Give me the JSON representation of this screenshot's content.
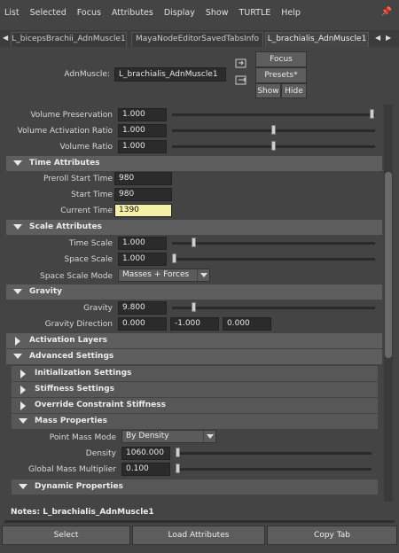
{
  "menu": [
    "List",
    "Selected",
    "Focus",
    "Attributes",
    "Display",
    "Show",
    "TURTLE",
    "Help"
  ],
  "tabs": [
    "L_bicepsBrachii_AdnMuscle1",
    "MayaNodeEditorSavedTabsInfo",
    "L_brachialis_AdnMuscle1"
  ],
  "node": {
    "label": "AdnMuscle:",
    "value": "L_brachialis_AdnMuscle1",
    "focus": "Focus",
    "presets": "Presets*",
    "show": "Show",
    "hide": "Hide"
  },
  "top_attrs": [
    {
      "label": "Volume Preservation",
      "value": "1.000",
      "slider": 1.0
    },
    {
      "label": "Volume Activation Ratio",
      "value": "1.000",
      "slider": 0.5
    },
    {
      "label": "Volume Ratio",
      "value": "1.000",
      "slider": 0.5
    }
  ],
  "time": {
    "title": "Time Attributes",
    "preroll_label": "Preroll Start Time",
    "preroll": "980",
    "start_label": "Start Time",
    "start": "980",
    "current_label": "Current Time",
    "current": "1390"
  },
  "scale": {
    "title": "Scale Attributes",
    "time_scale_label": "Time Scale",
    "time_scale": "1.000",
    "time_scale_slider": 0.1,
    "space_scale_label": "Space Scale",
    "space_scale": "1.000",
    "space_scale_slider": 0.0,
    "mode_label": "Space Scale Mode",
    "mode": "Masses + Forces"
  },
  "gravity": {
    "title": "Gravity",
    "gravity_label": "Gravity",
    "gravity": "9.800",
    "gravity_slider": 0.1,
    "dir_label": "Gravity Direction",
    "dir": [
      "0.000",
      "-1.000",
      "0.000"
    ]
  },
  "sections": {
    "activation": "Activation Layers",
    "advanced": "Advanced Settings",
    "init": "Initialization Settings",
    "stiffness": "Stiffness Settings",
    "override": "Override Constraint Stiffness",
    "mass": "Mass Properties",
    "dynamic": "Dynamic Properties"
  },
  "mass": {
    "mode_label": "Point Mass Mode",
    "mode": "By Density",
    "density_label": "Density",
    "density": "1060.000",
    "density_slider": 0.0,
    "gmm_label": "Global Mass Multiplier",
    "gmm": "0.100",
    "gmm_slider": 0.0
  },
  "notes": "Notes:  L_brachialis_AdnMuscle1",
  "buttons": {
    "select": "Select",
    "load": "Load Attributes",
    "copy": "Copy Tab"
  }
}
